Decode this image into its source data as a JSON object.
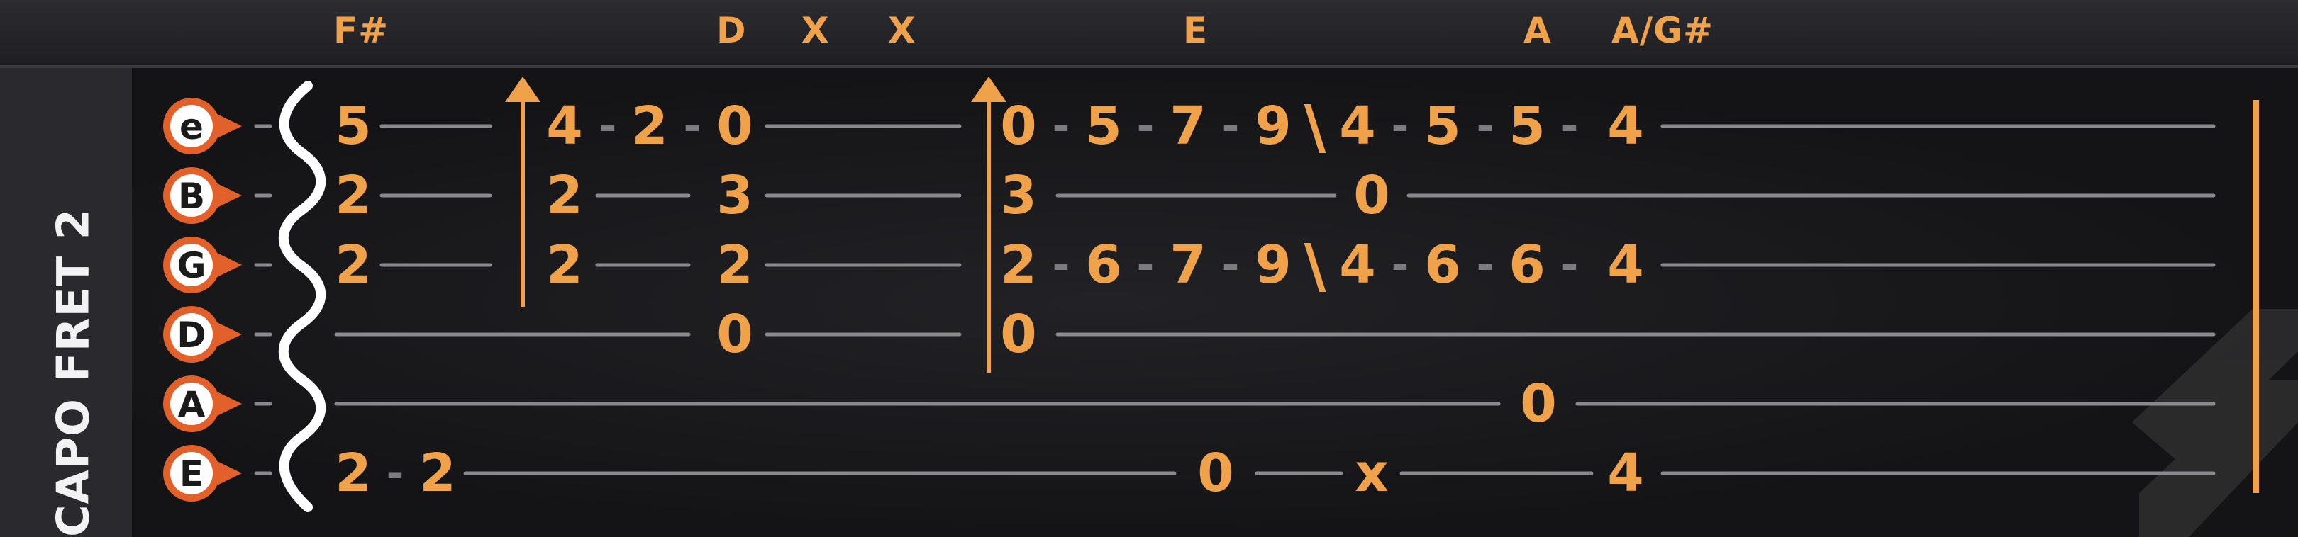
{
  "capo_label": "CAPO FRET 2",
  "colors": {
    "accent": "#efa24a",
    "string_line": "#8a8a8e",
    "string_badge_outer": "#e2612b",
    "string_badge_inner": "#ffffff",
    "background": "#141416"
  },
  "chords": [
    "F#",
    "D",
    "X",
    "X",
    "E",
    "A",
    "A/G#"
  ],
  "strings": [
    "e",
    "B",
    "G",
    "D",
    "A",
    "E"
  ],
  "tab_rows": [
    {
      "string": "e",
      "notes": [
        "5",
        "4",
        "-",
        "2",
        "-",
        "0",
        "0",
        "-",
        "5",
        "-",
        "7",
        "-",
        "9",
        "\\",
        "4",
        "-",
        "5",
        "-",
        "5",
        "-",
        "4"
      ]
    },
    {
      "string": "B",
      "notes": [
        "2",
        "2",
        "3",
        "3",
        "0"
      ]
    },
    {
      "string": "G",
      "notes": [
        "2",
        "2",
        "2",
        "2",
        "-",
        "6",
        "-",
        "7",
        "-",
        "9",
        "\\",
        "4",
        "-",
        "6",
        "-",
        "6",
        "-",
        "4"
      ]
    },
    {
      "string": "D",
      "notes": [
        "0",
        "0"
      ]
    },
    {
      "string": "A",
      "notes": [
        "0"
      ]
    },
    {
      "string": "E",
      "notes": [
        "2",
        "-",
        "2",
        "0",
        "x",
        "4"
      ]
    }
  ],
  "strum_icons": [
    "strum-up-arrow-icon",
    "strum-up-arrow-icon"
  ]
}
